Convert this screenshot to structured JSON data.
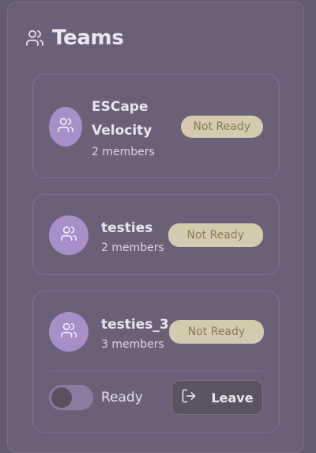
{
  "header": {
    "title": "Teams",
    "icon": "users-icon"
  },
  "teams": [
    {
      "name_line1": "ESCape",
      "name_line2": "Velocity",
      "members": "2 members",
      "status": "Not Ready",
      "icon": "users-icon"
    },
    {
      "name": "testies",
      "members": "2 members",
      "status": "Not Ready",
      "icon": "users-icon"
    },
    {
      "name": "testies_3",
      "members": "3 members",
      "status": "Not Ready",
      "icon": "users-icon"
    }
  ],
  "controls": {
    "ready_label": "Ready",
    "ready_on": false,
    "leave_label": "Leave",
    "leave_icon": "log-out-icon"
  },
  "colors": {
    "background": "#645b70",
    "panel": "#6b6078",
    "avatar": "#a98fc8",
    "badge_bg": "#d4cab0",
    "badge_text": "#8a7a4e"
  }
}
